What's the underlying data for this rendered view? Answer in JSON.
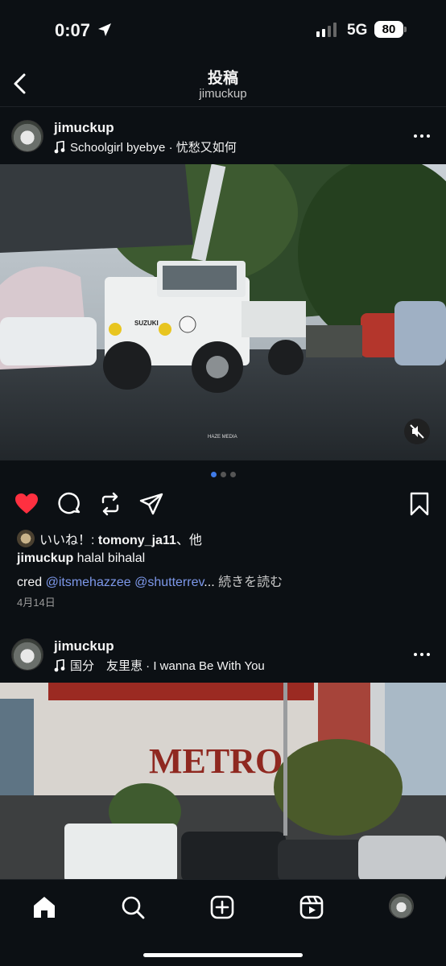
{
  "status_bar": {
    "time": "0:07",
    "network": "5G",
    "battery": "80"
  },
  "header": {
    "title": "投稿",
    "subtitle": "jimuckup"
  },
  "posts": [
    {
      "username": "jimuckup",
      "music": "Schoolgirl byebye · 忧愁又如何",
      "photo_labels": [
        "SUZUKI",
        "HAZE MEDIA"
      ],
      "carousel": {
        "count": 3,
        "active": 0
      },
      "liked": true,
      "likes_prefix": "いいね！: ",
      "likes_user": "tomony_ja11",
      "likes_suffix": "、他",
      "caption_user": "jimuckup",
      "caption_text": " halal bihalal",
      "cred_prefix": "cred ",
      "mention_1": "@itsmehazzee",
      "mention_2": "@shutterrev",
      "ellipsis": "...",
      "read_more": " 続きを読む",
      "date": "4月14日"
    },
    {
      "username": "jimuckup",
      "music": "国分　友里恵 · I wanna Be With You",
      "photo_labels": [
        "METRO"
      ]
    }
  ],
  "colors": {
    "background": "#0c1014",
    "like_red": "#ff3040",
    "mention_blue": "#7d98ea",
    "carousel_active": "#3f7be8"
  },
  "icons": {
    "back": "chevron-left-icon",
    "like": "heart-icon",
    "comment": "comment-icon",
    "repost": "repost-icon",
    "share": "send-icon",
    "save": "bookmark-icon",
    "mute": "mute-icon",
    "music": "music-note-icon",
    "tabs": [
      "home-icon",
      "search-icon",
      "create-icon",
      "reels-icon",
      "profile-avatar"
    ]
  }
}
